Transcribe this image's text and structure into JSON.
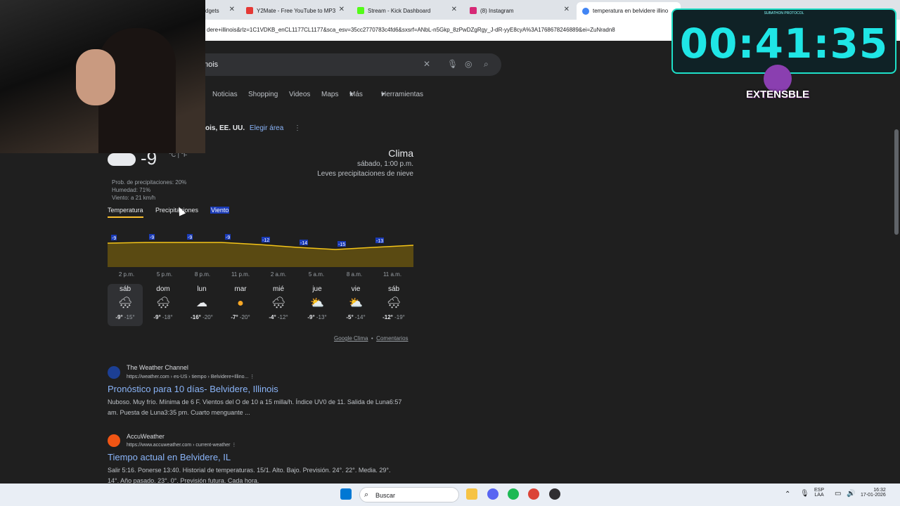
{
  "browser": {
    "tabs": [
      {
        "title": "dgets",
        "color": "#f28b25"
      },
      {
        "title": "Y2Mate - Free YouTube to MP3",
        "color": "#e53935"
      },
      {
        "title": "Stream - Kick Dashboard",
        "color": "#53fc18"
      },
      {
        "title": "(8) Instagram",
        "color": "#d62976"
      },
      {
        "title": "temperatura en belvidere illino",
        "color": "#4285f4"
      }
    ],
    "url": "dere+illinois&rlz=1C1VDKB_enCL1177CL1177&sca_esv=35cc2770783c4fd6&sxsrf=ANbL-n5Gkp_8zPwDZgRgy_J-dR-yyE8cyA%3A1768678246889&ei=ZuNradn8"
  },
  "search": {
    "query": "nois",
    "nav": [
      "Noticias",
      "Shopping",
      "Videos",
      "Maps",
      "Más",
      "Herramientas"
    ]
  },
  "weather": {
    "location": "ois, EE. UU.",
    "choose_area": "Elegir área",
    "title": "Clima",
    "datetime": "sábado, 1:00 p.m.",
    "condition": "Leves precipitaciones de nieve",
    "temp": "-9",
    "units": "°C | °F",
    "precip": "Prob. de precipitaciones: 20%",
    "humidity": "Humedad: 71%",
    "wind": "Viento: a 21 km/h",
    "tabs": [
      "Temperatura",
      "Precipitaciones",
      "Viento"
    ],
    "chart_labels": [
      "-9",
      "-9",
      "-9",
      "-9",
      "-12",
      "-14",
      "-15",
      "-13"
    ],
    "hours": [
      "2 p.m.",
      "5 p.m.",
      "8 p.m.",
      "11 p.m.",
      "2 a.m.",
      "5 a.m.",
      "8 a.m.",
      "11 a.m."
    ],
    "days": [
      {
        "name": "sáb",
        "icon": "snow-cloud-icon",
        "hi": "-9°",
        "lo": "-15°"
      },
      {
        "name": "dom",
        "icon": "snow-cloud-icon",
        "hi": "-9°",
        "lo": "-18°"
      },
      {
        "name": "lun",
        "icon": "cloud-icon",
        "hi": "-16°",
        "lo": "-20°"
      },
      {
        "name": "mar",
        "icon": "sun-icon",
        "hi": "-7°",
        "lo": "-20°"
      },
      {
        "name": "mié",
        "icon": "snow-cloud-icon",
        "hi": "-4°",
        "lo": "-12°"
      },
      {
        "name": "jue",
        "icon": "partly-cloudy-icon",
        "hi": "-9°",
        "lo": "-13°"
      },
      {
        "name": "vie",
        "icon": "partly-cloudy-icon",
        "hi": "-5°",
        "lo": "-14°"
      },
      {
        "name": "sáb",
        "icon": "snow-cloud-icon",
        "hi": "-12°",
        "lo": "-19°"
      }
    ],
    "footer_source": "Google Clima",
    "footer_feedback": "Comentarios"
  },
  "results": [
    {
      "site": "The Weather Channel",
      "url": "https://weather.com › es-US › tiempo › Belvidere+Illino...",
      "title": "Pronóstico para 10 días- Belvidere, Illinois",
      "snippet": "Nuboso. Muy frío. Mínima de 6 F. Vientos del O de 10 a 15 milla/h. Índice UV0 de 11. Salida de Luna6:57 am. Puesta de Luna3:35 pm. Cuarto menguante ...",
      "color": "#1c3f94"
    },
    {
      "site": "AccuWeather",
      "url": "https://www.accuweather.com › current-weather",
      "title": "Tiempo actual en Belvidere, IL",
      "snippet": "Salir 5:16. Ponerse 13:40. Historial de temperaturas. 15/1. Alto. Bajo. Previsión. 24°. 22°. Media. 29°. 14°. Año pasado. 23°. 0°. Previsión futura. Cada hora.",
      "color": "#f05514"
    }
  ],
  "overlay": {
    "timer": "00:41:35",
    "protocol": "SUBATHON PROTOCOL",
    "brand": "EXTENSBLE"
  },
  "taskbar": {
    "search_label": "Buscar",
    "lang_top": "ESP",
    "lang_bottom": "LAA",
    "time": "16:32",
    "date": "17-01-2026"
  }
}
